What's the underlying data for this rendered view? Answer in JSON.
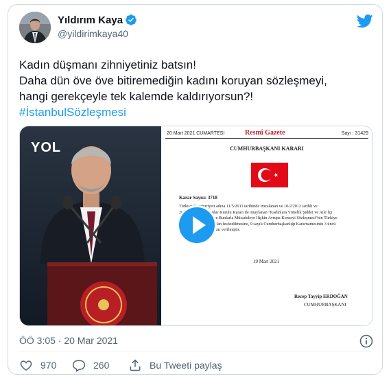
{
  "user": {
    "name": "Yıldırım Kaya",
    "handle": "@yildirimkaya40"
  },
  "tweet": {
    "lines": [
      "Kadın düşmanı zihniyetiniz batsın!",
      "Daha dün öve öve bitiremediğin kadını koruyan sözleşmeyi,",
      "hangi gerekçeyle tek kalemde kaldırıyorsun?!"
    ],
    "hashtag": "#İstanbulSözleşmesi"
  },
  "media": {
    "video_logo": "YOL",
    "document": {
      "date_header": "20 Mart 2021 CUMARTESİ",
      "gazette_title": "Resmî Gazete",
      "issue_number": "Sayı : 31429",
      "heading": "CUMHURBAŞKANI KARARI",
      "decision_number": "Karar Sayısı: 3718",
      "body_lines": [
        "Türkiye Cumhuriyeti adına 11/5/2011 tarihinde imzalanan ve 10/2/2012 tarihli ve",
        "2012/... sayılı Bakanlar Kurulu Kararı ile onaylanan \"Kadınlara Yönelik Şiddet ve Aile İçi",
        "Şiddetin Önlenmesi ve Bunlarla Mücadeleye İlişkin Avrupa Konseyi Sözleşmesi\"nin Türkiye",
        "Cumhuriyeti bakımından feshedilmesine, 9 sayılı Cumhurbaşkanlığı Kararnamesinin 3 üncü",
        "maddesi gereğince karar verilmiştir."
      ],
      "sign_date": "19 Mart 2021",
      "signer": "Recep Tayyip ERDOĞAN",
      "signer_title": "CUMHURBAŞKANI"
    }
  },
  "timestamp": "ÖÖ 3:05 · 20 Mar 2021",
  "actions": {
    "likes": "970",
    "replies": "260",
    "share_label": "Bu Tweeti paylaş"
  },
  "colors": {
    "accent": "#1d9bf0",
    "flag_red": "#e30a17",
    "gazette_red": "#c0202a"
  }
}
